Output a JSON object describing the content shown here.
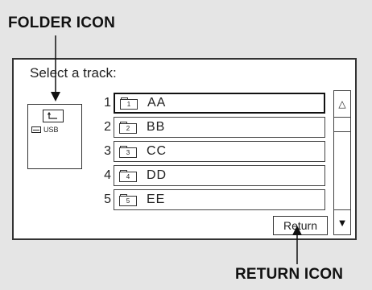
{
  "callouts": {
    "folder_icon": "FOLDER ICON",
    "return_icon": "RETURN ICON"
  },
  "screen": {
    "prompt": "Select a track:",
    "folder_panel": {
      "up_folder_icon": "folder-up-icon",
      "usb_icon": "usb-drive-icon",
      "usb_label": "USB"
    },
    "tracks": [
      {
        "number": "1",
        "icon_label": "1",
        "name": "AA",
        "selected": true
      },
      {
        "number": "2",
        "icon_label": "2",
        "name": "BB",
        "selected": false
      },
      {
        "number": "3",
        "icon_label": "3",
        "name": "CC",
        "selected": false
      },
      {
        "number": "4",
        "icon_label": "4",
        "name": "DD",
        "selected": false
      },
      {
        "number": "5",
        "icon_label": "5",
        "name": "EE",
        "selected": false
      }
    ],
    "scroll_up_glyph": "△",
    "scroll_down_glyph": "▼",
    "return_label": "Return"
  }
}
